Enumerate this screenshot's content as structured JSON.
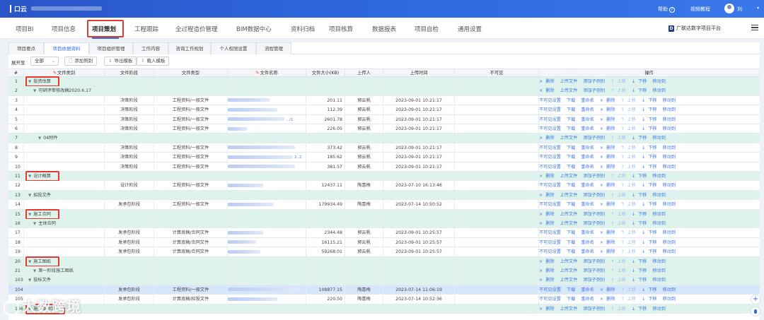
{
  "topbar": {
    "app_title": "口云",
    "help": "帮助",
    "video": "视频教程",
    "user": "刘",
    "help_icon": "question-circle-icon",
    "chevron_icon": "chevron-down-icon"
  },
  "nav": {
    "items": [
      "项目BI",
      "项目信息",
      "项目策划",
      "工程跟踪",
      "全过程造价管理",
      "BIM数据中心",
      "资料归档",
      "项目核算",
      "数据报表",
      "项目自检",
      "通用设置"
    ],
    "active_index": 2,
    "platform": "广联达数字项目平台",
    "accent_color": "#2d6ee8",
    "highlight_color": "#e23a2e"
  },
  "subtabs": {
    "items": [
      "项目要点",
      "项目依据资料",
      "项目组织管理",
      "工作内容",
      "咨询工作规划",
      "个人权限设置",
      "流程管理"
    ],
    "active_index": 1
  },
  "toolbar": {
    "expand_label": "展开至",
    "expand_value": "全部",
    "add_folder": "添加例别",
    "export_template": "导出模板",
    "import_template": "载入模板"
  },
  "table": {
    "headers": [
      "#",
      "文件类别",
      "文件阶段",
      "文件类型",
      "文件名称",
      "文件大小(KB)",
      "上传人",
      "上传时间",
      "不可见",
      "操作"
    ],
    "folder_ops": [
      "删除",
      "上传文件",
      "添加子例别",
      "上移",
      "下移",
      "移动到"
    ],
    "file_ops": [
      "不可见设置",
      "下载",
      "重命名",
      "删除",
      "上移",
      "下移",
      "移动到"
    ],
    "rows": [
      {
        "num": "1",
        "kind": "folder",
        "indent": 0,
        "category": "投资估算",
        "boxed": true
      },
      {
        "num": "2",
        "kind": "folder",
        "indent": 1,
        "category": "可研评审修改稿2020.6.17"
      },
      {
        "num": "3",
        "kind": "file",
        "stage": "决策阶段",
        "type": "工程资料/一般文件",
        "name_w": 60,
        "ext": "",
        "size": "201.11",
        "uploader": "郭云帆",
        "time": "2023-09-01 10:21:17"
      },
      {
        "num": "4",
        "kind": "file",
        "stage": "决策阶段",
        "type": "工程资料/一般文件",
        "name_w": 70,
        "ext": "",
        "size": "112.39",
        "uploader": "郭云帆",
        "time": "2023-09-01 10:21:17"
      },
      {
        "num": "5",
        "kind": "file",
        "stage": "决策阶段",
        "type": "工程资料/一般文件",
        "name_w": 80,
        "ext": "...l1",
        "size": "2601.78",
        "uploader": "郭云帆",
        "time": "2023-09-01 10:21:17"
      },
      {
        "num": "6",
        "kind": "file",
        "stage": "决策阶段",
        "type": "工程资料/一般文件",
        "name_w": 28,
        "ext": "",
        "size": "226.05",
        "uploader": "郭云帆",
        "time": "2023-09-01 10:21:17"
      },
      {
        "num": "7",
        "kind": "folder",
        "indent": 2,
        "category": "04附件"
      },
      {
        "num": "8",
        "kind": "file",
        "stage": "决策阶段",
        "type": "工程资料/一般文件",
        "name_w": 95,
        "ext": "",
        "size": "373.42",
        "uploader": "郭云帆",
        "time": "2023-09-01 10:21:17"
      },
      {
        "num": "9",
        "kind": "file",
        "stage": "决策阶段",
        "type": "工程资料/一般文件",
        "name_w": 92,
        "ext": "2..2",
        "size": "185.62",
        "uploader": "郭云帆",
        "time": "2023-09-01 10:21:17"
      },
      {
        "num": "10",
        "kind": "file",
        "stage": "决策阶段",
        "type": "工程资料/一般文件",
        "name_w": 95,
        "ext": "",
        "size": "381.57",
        "uploader": "郭云帆",
        "time": "2023-09-01 10:21:17"
      },
      {
        "num": "11",
        "kind": "folder",
        "indent": 0,
        "category": "设计概算",
        "boxed": true
      },
      {
        "num": "12",
        "kind": "file",
        "stage": "设计阶段",
        "type": "工程资料/一般文件",
        "name_w": 50,
        "ext": "",
        "size": "12437.11",
        "uploader": "陶喜梅",
        "time": "2023-07-10 16:13:46"
      },
      {
        "num": "13",
        "kind": "folder",
        "indent": 0,
        "category": "招投文件"
      },
      {
        "num": "14",
        "kind": "file",
        "stage": "发承包阶段",
        "type": "工程资料/一般文件",
        "name_w": 65,
        "ext": "",
        "size": "179934.49",
        "uploader": "陶喜梅",
        "time": "2023-07-14 10:50:52"
      },
      {
        "num": "15",
        "kind": "folder",
        "indent": 0,
        "category": "施工合同",
        "boxed": true
      },
      {
        "num": "16",
        "kind": "folder",
        "indent": 1,
        "category": "主体合同"
      },
      {
        "num": "17",
        "kind": "file",
        "stage": "发承包阶段",
        "type": "计算底稿/合同文件",
        "name_w": 50,
        "ext": "",
        "size": "2344.48",
        "uploader": "郭云帆",
        "time": "2023-09-01 10:25:57"
      },
      {
        "num": "18",
        "kind": "file",
        "stage": "发承包阶段",
        "type": "计算底稿/合同文件",
        "name_w": 40,
        "ext": "",
        "size": "16115.21",
        "uploader": "郭云帆",
        "time": "2023-09-01 10:25:57"
      },
      {
        "num": "19",
        "kind": "file",
        "stage": "发承包阶段",
        "type": "计算底稿/合同文件",
        "name_w": 46,
        "ext": "",
        "size": "59268.01",
        "uploader": "郭云帆",
        "time": "2023-09-01 10:25:57"
      },
      {
        "num": "20",
        "kind": "folder",
        "indent": 0,
        "category": "施工图纸",
        "boxed": true
      },
      {
        "num": "21",
        "kind": "folder",
        "indent": 1,
        "category": "第一阶段施工图纸"
      },
      {
        "num": "103",
        "kind": "folder",
        "indent": 0,
        "category": "投标文件"
      },
      {
        "num": "104",
        "kind": "file",
        "stage": "发承包阶段",
        "type": "工程资料/一般文件",
        "name_w": 100,
        "ext": "",
        "size": "108877.15",
        "uploader": "陶喜梅",
        "time": "2023-07-14 11:06:19",
        "selected": true
      },
      {
        "num": "105",
        "kind": "file",
        "stage": "发承包阶段",
        "type": "计算底稿/招投文件",
        "name_w": 70,
        "ext": "",
        "size": "220.50",
        "uploader": "陶喜梅",
        "time": "2023-07-14 10:52:36"
      },
      {
        "num": "106",
        "kind": "folder",
        "indent": 0,
        "category": "施工图预算",
        "boxed": true
      }
    ]
  },
  "watermark": "大数跨境",
  "side_buttons": [
    "plus-icon",
    "location-pin-icon"
  ]
}
